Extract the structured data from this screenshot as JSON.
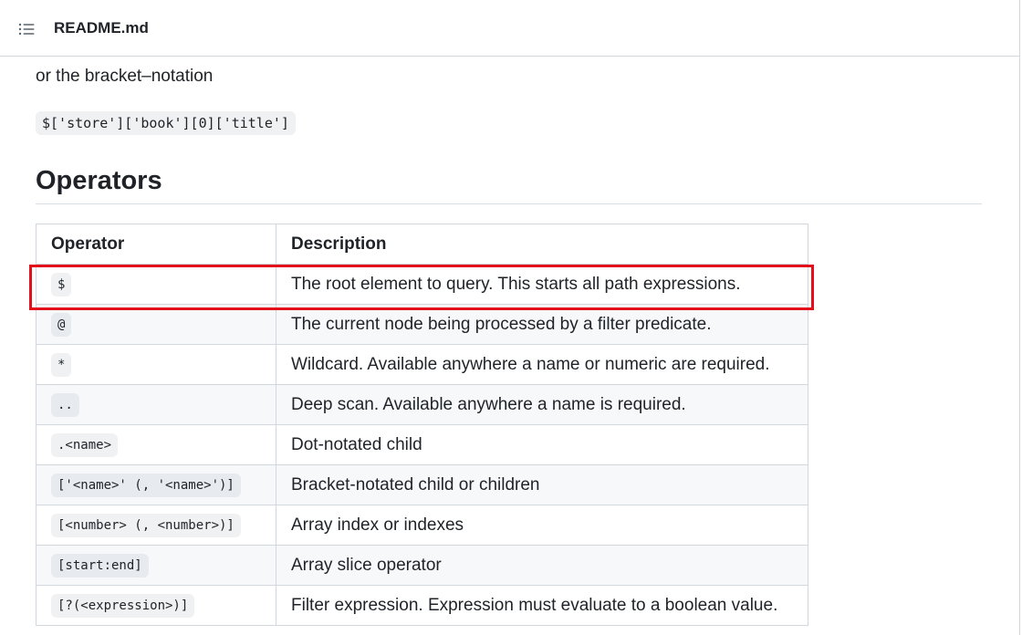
{
  "header": {
    "toc_icon": "list-unordered-icon",
    "file_name": "README.md"
  },
  "intro": {
    "text": "or the bracket–notation",
    "code": "$['store']['book'][0]['title']"
  },
  "section": {
    "heading": "Operators"
  },
  "table": {
    "headers": {
      "operator": "Operator",
      "description": "Description"
    },
    "rows": [
      {
        "operator": "$",
        "description": "The root element to query. This starts all path expressions."
      },
      {
        "operator": "@",
        "description": "The current node being processed by a filter predicate."
      },
      {
        "operator": "*",
        "description": "Wildcard. Available anywhere a name or numeric are required."
      },
      {
        "operator": "..",
        "description": "Deep scan. Available anywhere a name is required."
      },
      {
        "operator": ".<name>",
        "description": "Dot-notated child"
      },
      {
        "operator": "['<name>' (, '<name>')]",
        "description": "Bracket-notated child or children"
      },
      {
        "operator": "[<number> (, <number>)]",
        "description": "Array index or indexes"
      },
      {
        "operator": "[start:end]",
        "description": "Array slice operator"
      },
      {
        "operator": "[?(<expression>)]",
        "description": "Filter expression. Expression must evaluate to a boolean value."
      }
    ]
  },
  "annotation": {
    "highlight_color": "#e3101b",
    "highlighted_row": 0
  }
}
